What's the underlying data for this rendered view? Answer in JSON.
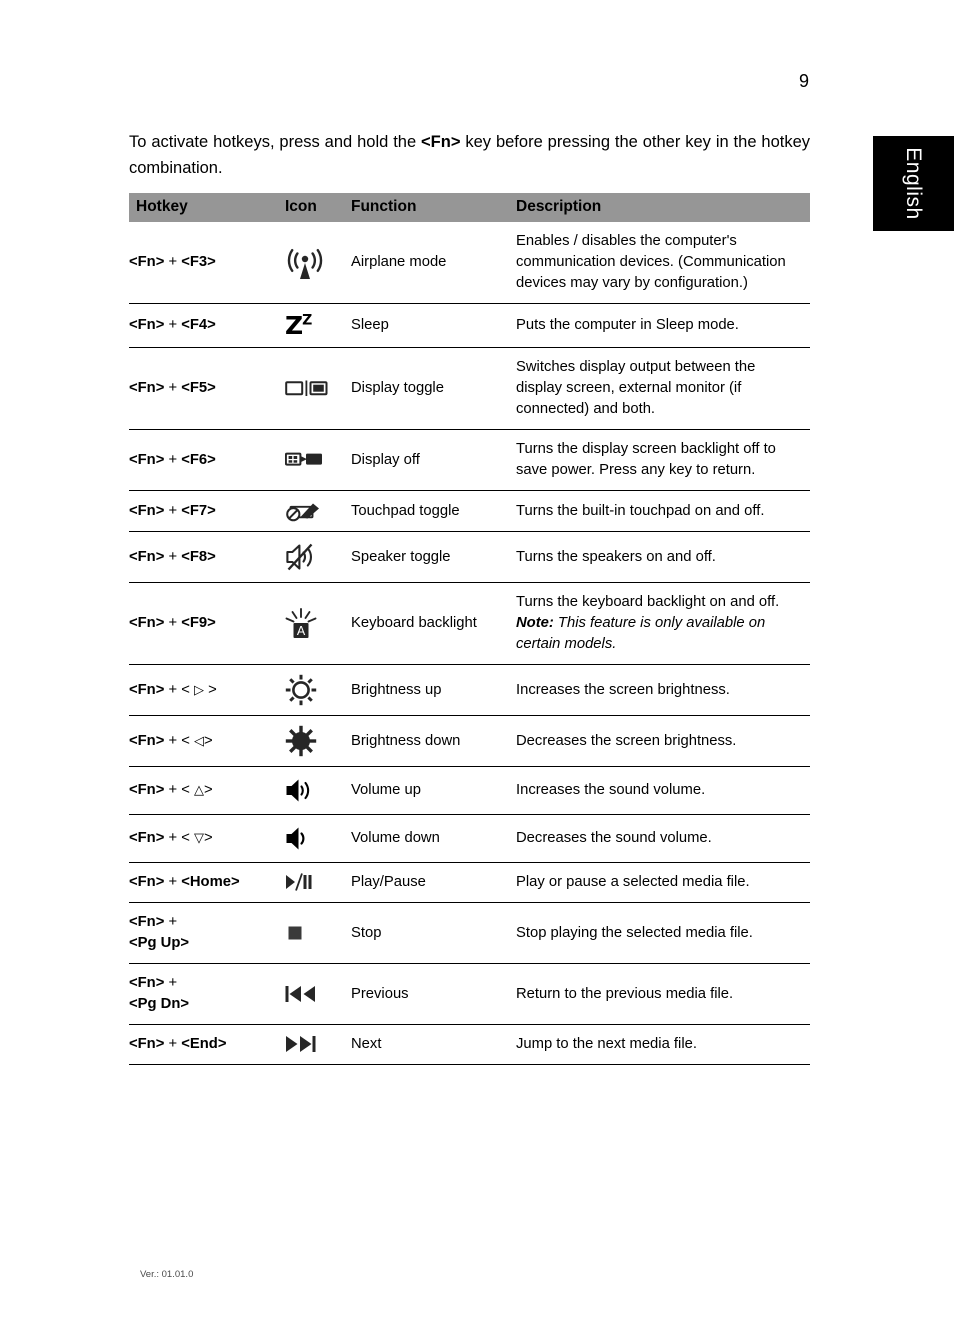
{
  "page": {
    "number": "9",
    "language_tab": "English",
    "footer": "Ver.: 01.01.0"
  },
  "intro": {
    "before": "To activate hotkeys, press and hold the ",
    "key": "<Fn>",
    "after": " key before pressing the other key in the hotkey combination."
  },
  "table": {
    "headers": {
      "hotkey": "Hotkey",
      "icon": "Icon",
      "function": "Function",
      "description": "Description"
    },
    "rows": [
      {
        "hotkey_prefix": "<Fn> + ",
        "hotkey_key": "<F3>",
        "icon": "airplane-mode-icon",
        "function": "Airplane mode",
        "description": "Enables / disables the computer's communication devices. (Communication devices may vary by configuration.)"
      },
      {
        "hotkey_prefix": "<Fn> + ",
        "hotkey_key": "<F4>",
        "icon": "sleep-icon",
        "function": "Sleep",
        "description": "Puts the computer in Sleep mode."
      },
      {
        "hotkey_prefix": "<Fn> + ",
        "hotkey_key": "<F5>",
        "icon": "display-toggle-icon",
        "function": "Display toggle",
        "description": "Switches display output between the display screen, external monitor (if connected) and both."
      },
      {
        "hotkey_prefix": "<Fn> + ",
        "hotkey_key": "<F6>",
        "icon": "display-off-icon",
        "function": "Display off",
        "description": "Turns the display screen backlight off to save power. Press any key to return."
      },
      {
        "hotkey_prefix": "<Fn> + ",
        "hotkey_key": "<F7>",
        "icon": "touchpad-toggle-icon",
        "function": "Touchpad toggle",
        "description": "Turns the built-in touchpad on and off."
      },
      {
        "hotkey_prefix": "<Fn> + ",
        "hotkey_key": "<F8>",
        "icon": "speaker-toggle-icon",
        "function": "Speaker toggle",
        "description": "Turns the speakers on and off."
      },
      {
        "hotkey_prefix": "<Fn> + ",
        "hotkey_key": "<F9>",
        "icon": "keyboard-backlight-icon",
        "function": "Keyboard backlight",
        "description": "Turns the keyboard backlight on and off.",
        "note_label": "Note:",
        "note_text": " This feature is only available on certain models."
      },
      {
        "hotkey_prefix": "<Fn> + < ",
        "hotkey_arrow": "▷",
        "hotkey_suffix": " >",
        "icon": "brightness-up-icon",
        "function": "Brightness up",
        "description": "Increases the screen brightness."
      },
      {
        "hotkey_prefix": "<Fn> + < ",
        "hotkey_arrow": "◁",
        "hotkey_suffix": ">",
        "icon": "brightness-down-icon",
        "function": "Brightness down",
        "description": "Decreases the screen brightness."
      },
      {
        "hotkey_prefix": "<Fn> + < ",
        "hotkey_arrow": "△",
        "hotkey_suffix": ">",
        "icon": "volume-up-icon",
        "function": "Volume up",
        "description": "Increases the sound volume."
      },
      {
        "hotkey_prefix": "<Fn> + <",
        "hotkey_arrow": "▽",
        "hotkey_suffix": ">",
        "icon": "volume-down-icon",
        "function": "Volume down",
        "description": "Decreases the sound volume."
      },
      {
        "hotkey_prefix": "<Fn> + ",
        "hotkey_key": "<Home>",
        "icon": "play-pause-icon",
        "icon_glyph": "▶/❘❘",
        "function": "Play/Pause",
        "description": "Play or pause a selected media file."
      },
      {
        "hotkey_prefix": "<Fn> + ",
        "hotkey_key": "<Pg Up>",
        "hotkey_wrap": true,
        "icon": "stop-icon",
        "icon_glyph": "■",
        "function": "Stop",
        "description": "Stop playing the selected media file."
      },
      {
        "hotkey_prefix": "<Fn> + ",
        "hotkey_key": "<Pg Dn>",
        "hotkey_wrap": true,
        "icon": "previous-icon",
        "icon_glyph": "❘◀◀",
        "function": "Previous",
        "description": "Return to the previous media file."
      },
      {
        "hotkey_prefix": "<Fn> + ",
        "hotkey_key": "<End>",
        "icon": "next-icon",
        "icon_glyph": "▶▶❘",
        "function": "Next",
        "description": "Jump to the next media file."
      }
    ]
  }
}
